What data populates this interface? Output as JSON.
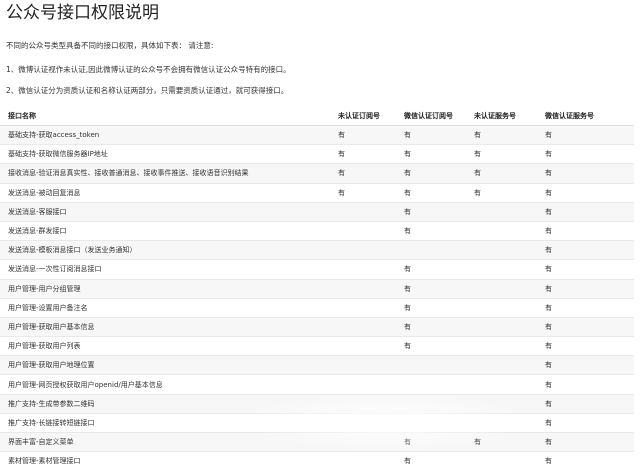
{
  "title": "公众号接口权限说明",
  "intro": "不同的公众号类型具备不同的接口权限，具体如下表： 请注意:",
  "notes": [
    "1、微博认证视作未认证,因此微博认证的公众号不会拥有微信认证公众号特有的接口。",
    "2、微信认证分为资质认证和名称认证两部分，只需要资质认证通过，就可获得接口。"
  ],
  "table": {
    "headers": [
      "接口名称",
      "未认证订阅号",
      "微信认证订阅号",
      "未认证服务号",
      "微信认证服务号"
    ],
    "rows": [
      [
        "基础支持-获取access_token",
        "有",
        "有",
        "有",
        "有"
      ],
      [
        "基础支持-获取微信服务器IP地址",
        "有",
        "有",
        "有",
        "有"
      ],
      [
        "接收消息-验证消息真实性、接收普通消息、接收事件推送、接收语音识别结果",
        "有",
        "有",
        "有",
        "有"
      ],
      [
        "发送消息-被动回复消息",
        "有",
        "有",
        "有",
        "有"
      ],
      [
        "发送消息-客服接口",
        "",
        "有",
        "",
        "有"
      ],
      [
        "发送消息-群发接口",
        "",
        "有",
        "",
        "有"
      ],
      [
        "发送消息-模板消息接口（发送业务通知）",
        "",
        "",
        "",
        "有"
      ],
      [
        "发送消息-一次性订阅消息接口",
        "",
        "有",
        "",
        "有"
      ],
      [
        "用户管理-用户分组管理",
        "",
        "有",
        "",
        "有"
      ],
      [
        "用户管理-设置用户备注名",
        "",
        "有",
        "",
        "有"
      ],
      [
        "用户管理-获取用户基本信息",
        "",
        "有",
        "",
        "有"
      ],
      [
        "用户管理-获取用户列表",
        "",
        "有",
        "",
        "有"
      ],
      [
        "用户管理-获取用户地理位置",
        "",
        "",
        "",
        "有"
      ],
      [
        "用户管理-网页授权获取用户openid/用户基本信息",
        "",
        "",
        "",
        "有"
      ],
      [
        "推广支持-生成带参数二维码",
        "",
        "",
        "",
        "有"
      ],
      [
        "推广支持-长链接转短链接口",
        "",
        "",
        "",
        "有"
      ],
      [
        "界面丰富-自定义菜单",
        "",
        "有",
        "有",
        "有"
      ],
      [
        "素材管理-素材管理接口",
        "",
        "有",
        "",
        "有"
      ]
    ]
  }
}
